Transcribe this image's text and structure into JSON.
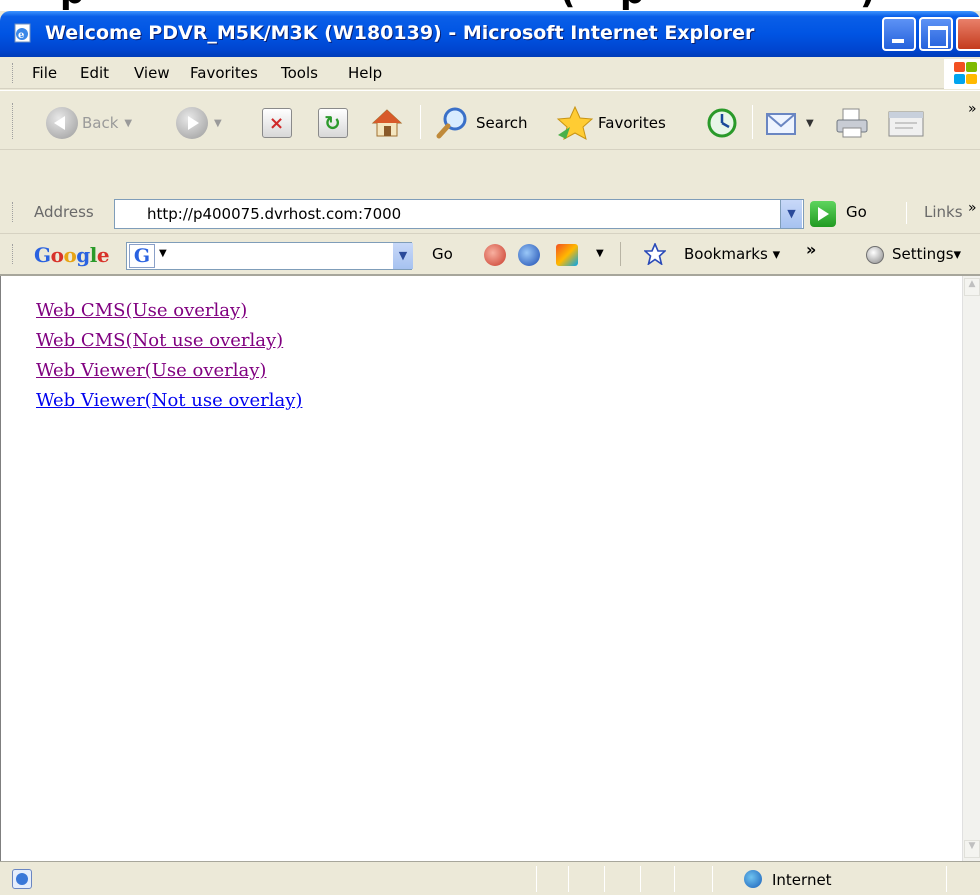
{
  "window": {
    "title": "Welcome PDVR_M5K/M3K (W180139) - Microsoft Internet Explorer"
  },
  "menu": [
    "File",
    "Edit",
    "View",
    "Favorites",
    "Tools",
    "Help"
  ],
  "toolbar": {
    "back": "Back",
    "search": "Search",
    "favorites": "Favorites"
  },
  "address": {
    "label": "Address",
    "url": "http://p400075.dvrhost.com:7000",
    "go": "Go",
    "links": "Links"
  },
  "googlebar": {
    "logo": "Google",
    "go": "Go",
    "bookmarks": "Bookmarks",
    "settings": "Settings"
  },
  "content": {
    "links": [
      {
        "text": "Web CMS(Use overlay)",
        "state": "visited"
      },
      {
        "text": "Web CMS(Not use overlay)",
        "state": "visited"
      },
      {
        "text": "Web Viewer(Use overlay)",
        "state": "visited"
      },
      {
        "text": "Web Viewer(Not use overlay)",
        "state": "unvisited"
      }
    ]
  },
  "statusbar": {
    "zone": "Internet"
  },
  "colors": {
    "titlebar": "#0054e3",
    "visited_link": "#800080",
    "unvisited_link": "#0000ee",
    "chrome": "#ece9d8"
  },
  "icons": [
    "ie-page-icon",
    "minimize-icon",
    "maximize-icon",
    "close-icon",
    "back-icon",
    "forward-icon",
    "stop-icon",
    "refresh-icon",
    "home-icon",
    "search-icon",
    "favorites-star-icon",
    "history-icon",
    "mail-icon",
    "print-icon",
    "edit-icon",
    "go-arrow-icon",
    "globe-icon"
  ]
}
